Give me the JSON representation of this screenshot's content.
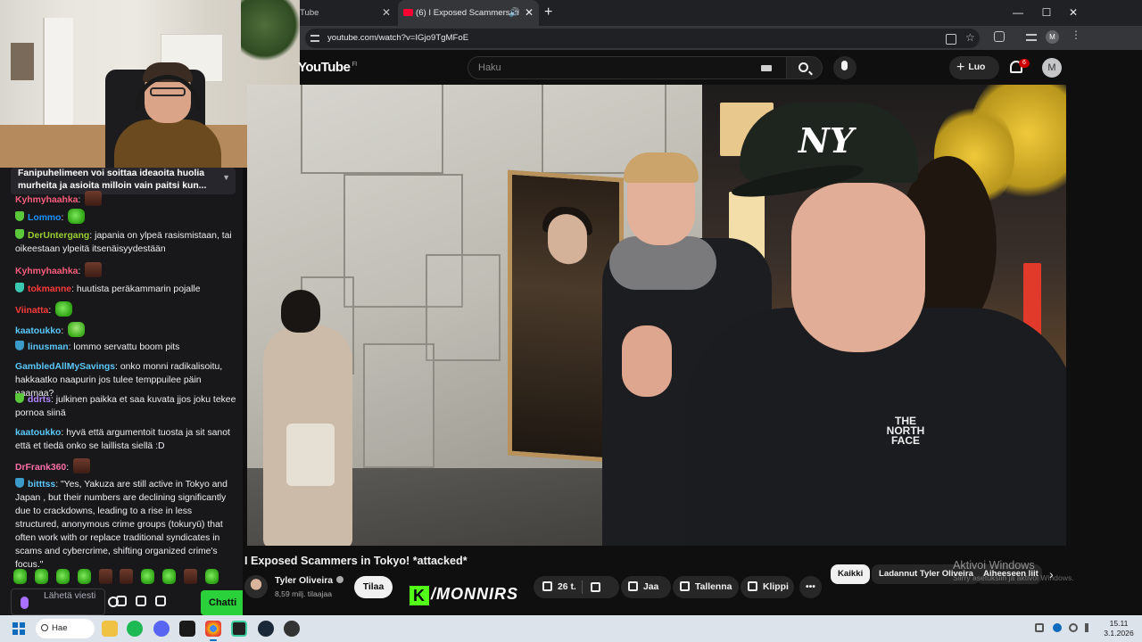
{
  "chat": {
    "pinned": "Fanipuhelimeen voi soittaa ideaoita huolia murheita ja asioita milloin vain paitsi kun...",
    "messages": [
      {
        "user": "Kyhmyhaahka",
        "text": "",
        "color": "#ff5d7e",
        "emote": "r"
      },
      {
        "user": "Lommo",
        "text": "",
        "color": "#1e90ff",
        "emote": "g"
      },
      {
        "user": "DerUntergang",
        "text": "japania on ylpeä rasismistaan, tai oikeestaan ylpeitä itsenäisyydestään",
        "color": "#9acd32"
      },
      {
        "user": "Kyhmyhaahka",
        "text": "",
        "color": "#ff5d7e",
        "emote": "r"
      },
      {
        "user": "tokmanne",
        "text": "huutista peräkammarin pojalle",
        "color": "#ff3a3a"
      },
      {
        "user": "Viinatta",
        "text": "",
        "color": "#ff3a3a",
        "emote": "g"
      },
      {
        "user": "kaatoukko",
        "text": "",
        "color": "#5ac8fa",
        "emote": "g"
      },
      {
        "user": "linusman",
        "text": "lommo servattu boom pits",
        "color": "#5ac8fa"
      },
      {
        "user": "GambledAllMySavings",
        "text": "onko monni radikalisoitu, hakkaatko naapurin jos tulee temppuilee päin naamaa?",
        "color": "#5ac8fa"
      },
      {
        "user": "ddrts",
        "text": "julkinen paikka et saa kuvata jjos joku tekee pornoa siinä",
        "color": "#b388ff"
      },
      {
        "user": "kaatoukko",
        "text": "hyvä että argumentoit tuosta ja sit sanot että et tiedä onko se laillista siellä :D",
        "color": "#5ac8fa"
      },
      {
        "user": "DrFrank360",
        "text": "",
        "color": "#ff6fa8",
        "emote": "r"
      },
      {
        "user": "bitttss",
        "text": "\"Yes, Yakuza are still active in Tokyo and Japan , but their numbers are declining significantly due to crackdowns, leading to a rise in less structured, anonymous crime groups (tokuryū) that often work with or replace traditional syndicates in scams and cybercrime, shifting organized crime's focus.\"",
        "color": "#5ac8fa"
      }
    ],
    "input_placeholder": "Lähetä viesti",
    "send_label": "Chatti"
  },
  "browser": {
    "tab1_title": "Tube",
    "tab2_title": "(6) I Exposed Scammers in",
    "url_text": "youtube.com/watch?v=IGjo9TgMFoE",
    "avatar_letter": "M"
  },
  "youtube": {
    "logo": "YouTube",
    "logo_region": "FI",
    "search_placeholder": "Haku",
    "create_label": "Luo",
    "notif_count": "6",
    "avatar_letter": "M",
    "video_title": "I Exposed Scammers in Tokyo! *attacked*",
    "channel_name": "Tyler Oliveira",
    "subscribers": "8,59 milj. tilaajaa",
    "subscribe_label": "Tilaa",
    "like_count": "26 t.",
    "share_label": "Jaa",
    "save_label": "Tallenna",
    "clip_label": "Klippi",
    "more_label": "•••",
    "chips": [
      "Kaikki",
      "Ladannut Tyler Oliveira",
      "Aiheeseen liit"
    ],
    "video_overlay": {
      "ny": "NY",
      "brand": "THE NORTH FACE"
    }
  },
  "overlay": {
    "brand": "/MONNIRS",
    "brand_letter": "K",
    "activate_title": "Aktivoi Windows",
    "activate_sub": "Siirry asetuksiin ja aktivoi Windows."
  },
  "taskbar": {
    "search_label": "Hae",
    "time": "15.11",
    "date": "3.1.2026"
  }
}
